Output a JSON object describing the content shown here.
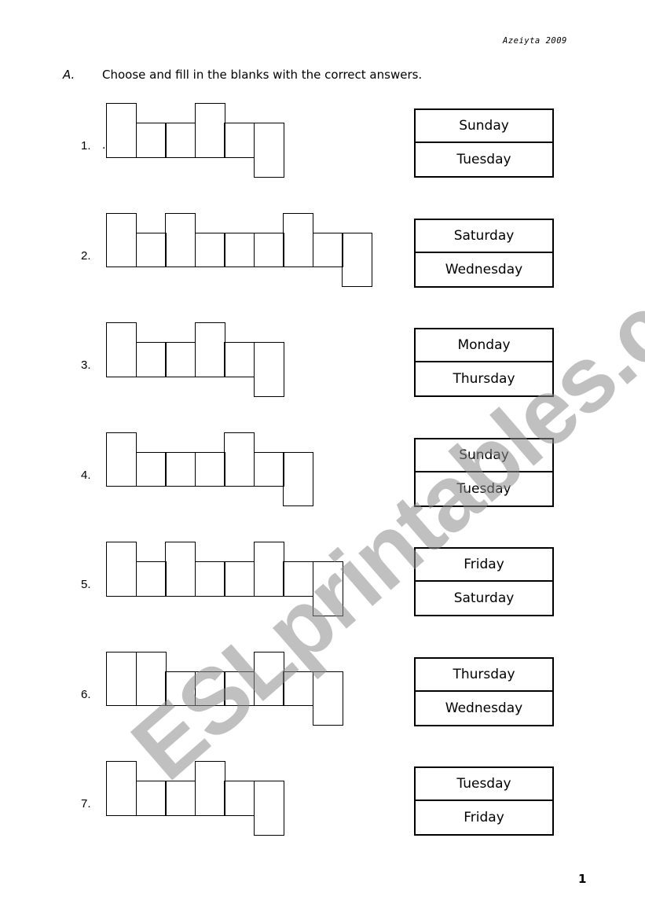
{
  "header": {
    "author": "Azeiyta 2009"
  },
  "section": {
    "letter": "A.",
    "instruction": "Choose and fill in the blanks with the correct answers."
  },
  "exercises": [
    {
      "number": "1.",
      "extra_mark": ".",
      "pattern": [
        "T",
        "M",
        "M",
        "T",
        "M",
        "D"
      ],
      "options": [
        "Sunday",
        "Tuesday"
      ]
    },
    {
      "number": "2.",
      "pattern": [
        "T",
        "M",
        "T",
        "M",
        "M",
        "M",
        "T",
        "M",
        "D"
      ],
      "options": [
        "Saturday",
        "Wednesday"
      ]
    },
    {
      "number": "3.",
      "pattern": [
        "T",
        "M",
        "M",
        "T",
        "M",
        "D"
      ],
      "options": [
        "Monday",
        "Thursday"
      ]
    },
    {
      "number": "4.",
      "pattern": [
        "T",
        "M",
        "M",
        "M",
        "T",
        "M",
        "D"
      ],
      "options": [
        "Sunday",
        "Tuesday"
      ]
    },
    {
      "number": "5.",
      "pattern": [
        "T",
        "M",
        "T",
        "M",
        "M",
        "T",
        "M",
        "D"
      ],
      "options": [
        "Friday",
        "Saturday"
      ]
    },
    {
      "number": "6.",
      "pattern": [
        "T",
        "T",
        "M",
        "M",
        "M",
        "T",
        "M",
        "D"
      ],
      "options": [
        "Thursday",
        "Wednesday"
      ]
    },
    {
      "number": "7.",
      "pattern": [
        "T",
        "M",
        "M",
        "T",
        "M",
        "D"
      ],
      "options": [
        "Tuesday",
        "Friday"
      ]
    }
  ],
  "footer": {
    "page_number": "1"
  },
  "watermark": "ESLprintables.com"
}
